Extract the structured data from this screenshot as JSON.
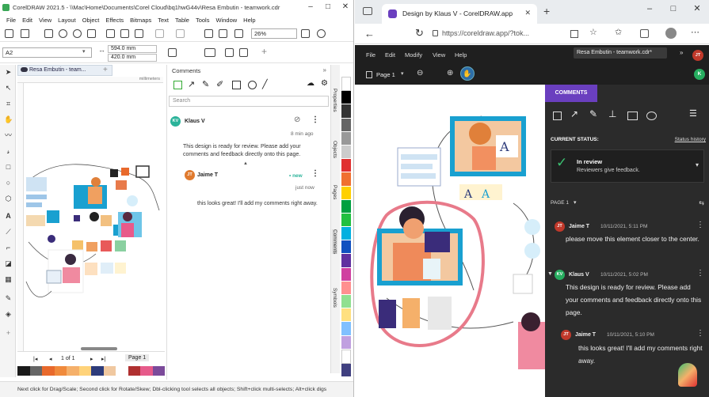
{
  "left_app": {
    "window_title": "CorelDRAW 2021.5 - \\\\Mac\\Home\\Documents\\Corel Cloud\\bq1hwG44v\\Resa Embutin - teamwork.cdr",
    "menu": [
      "File",
      "Edit",
      "View",
      "Layout",
      "Object",
      "Effects",
      "Bitmaps",
      "Text",
      "Table",
      "Tools",
      "Window",
      "Help"
    ],
    "zoom": "26%",
    "paper_size": "A2",
    "width_value": "594.0 mm",
    "height_value": "420.0 mm",
    "doc_tab": "Resa Embutin - team...",
    "ruler_unit": "millimeters",
    "page_nav": "1 of 1",
    "page_tab": "Page 1",
    "status_text": "Next click for Drag/Scale; Second click for Rotate/Skew; Dbl-clicking tool selects all objects; Shift+click multi-selects; Alt+click digs",
    "comments_docker": {
      "title": "Comments",
      "search_placeholder": "Search",
      "comments": [
        {
          "initials": "KV",
          "author": "Klaus V",
          "time": "8 min ago",
          "body": "This design is ready for review. Please add your comments and feedback directly onto this page.",
          "avatar_color": "#2bb39a"
        },
        {
          "initials": "JT",
          "author": "Jaime T",
          "badge": "• new",
          "time": "just now",
          "body": "this looks great! I'll add my comments right away.",
          "avatar_color": "#e07a2e"
        }
      ]
    },
    "side_tabs": [
      "Properties",
      "Objects",
      "Pages",
      "Comments",
      "Symbols"
    ],
    "palette_colors": [
      "#1a1a1a",
      "#666666",
      "#e8692c",
      "#f08a3c",
      "#f5b06a",
      "#ffd37a",
      "#2d3b7a",
      "#f0c8a0",
      "#ffffff",
      "#b03030",
      "#e65a8a",
      "#7b4a9a"
    ],
    "strip_colors": [
      "#ffffff",
      "#000000",
      "#333333",
      "#666666",
      "#999999",
      "#cccccc",
      "#e03030",
      "#f07030",
      "#ffd000",
      "#00a040",
      "#20c040",
      "#00b0e0",
      "#1050c0",
      "#6030a0",
      "#d040a0",
      "#ff9090",
      "#90e090",
      "#ffe080",
      "#80c0ff",
      "#c0a0e0",
      "#ffffff",
      "#404080"
    ]
  },
  "browser": {
    "tab_title": "Design by Klaus V - CorelDRAW.app",
    "url": "https://coreldraw.app/?tok...",
    "app_menu": [
      "File",
      "Edit",
      "Modify",
      "View",
      "Help"
    ],
    "page_selector": "Page 1",
    "doc_tooltip": "Resa Embutin - teamwork.cdr*",
    "user_initials": "JT",
    "user2_initials": "K",
    "panel": {
      "tab": "COMMENTS",
      "current_status_label": "CURRENT STATUS:",
      "status_history": "Status history",
      "status_title": "In review",
      "status_sub": "Reviewers give feedback.",
      "page_label": "PAGE 1",
      "comments": [
        {
          "initials": "JT",
          "author": "Jaime T",
          "time": "10/11/2021, 5:11 PM",
          "body": "please move this element closer to the center.",
          "avatar_color": "#c0392b"
        },
        {
          "initials": "KV",
          "author": "Klaus V",
          "time": "10/11/2021, 5:02 PM",
          "body": "This design is ready for review. Please add your comments and feedback directly onto this page.",
          "avatar_color": "#27ae60"
        },
        {
          "initials": "JT",
          "author": "Jaime T",
          "time": "10/11/2021, 5:10 PM",
          "body": "this looks great! I'll add my comments right away.",
          "avatar_color": "#c0392b"
        }
      ]
    }
  }
}
